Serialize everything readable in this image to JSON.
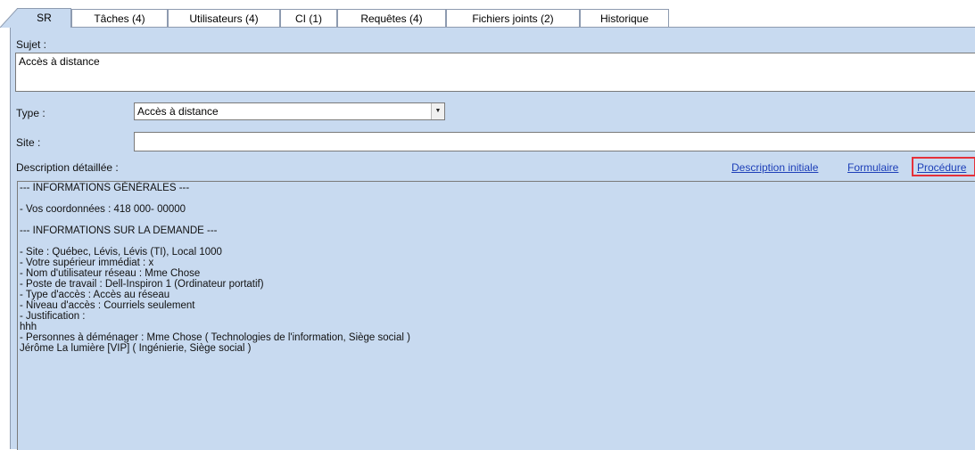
{
  "tabs": [
    {
      "label": "SR",
      "active": true
    },
    {
      "label": "Tâches (4)",
      "active": false
    },
    {
      "label": "Utilisateurs (4)",
      "active": false
    },
    {
      "label": "CI (1)",
      "active": false
    },
    {
      "label": "Requêtes (4)",
      "active": false
    },
    {
      "label": "Fichiers joints (2)",
      "active": false
    },
    {
      "label": "Historique",
      "active": false
    }
  ],
  "form": {
    "sujet_label": "Sujet :",
    "sujet_value": "Accès à distance",
    "type_label": "Type :",
    "type_value": "Accès à distance",
    "site_label": "Site :",
    "site_value": "",
    "description_label": "Description détaillée :"
  },
  "links": {
    "description_initiale": "Description initiale",
    "formulaire": "Formulaire",
    "procedure": "Procédure"
  },
  "description_lines": [
    "--- INFORMATIONS GÉNÉRALES ---",
    "",
    "- Vos coordonnées : 418 000- 00000",
    "",
    "--- INFORMATIONS SUR LA DEMANDE ---",
    "",
    "- Site : Québec, Lévis, Lévis (TI), Local 1000",
    "- Votre supérieur immédiat : x",
    "- Nom d'utilisateur réseau : Mme Chose",
    "- Poste de travail : Dell-Inspiron 1 (Ordinateur portatif)",
    "- Type d'accès : Accès au réseau",
    "- Niveau d'accès : Courriels seulement",
    "- Justification :",
    "hhh",
    "- Personnes à déménager : Mme Chose ( Technologies de l'information, Siège social )",
    "Jérôme La lumière [VIP] ( Ingénierie, Siège social )"
  ],
  "icons": {
    "dropdown": "chevron-down-icon"
  },
  "colors": {
    "panel_bg": "#c8daf0",
    "link": "#1d3fb8",
    "highlight": "#e5303a"
  }
}
